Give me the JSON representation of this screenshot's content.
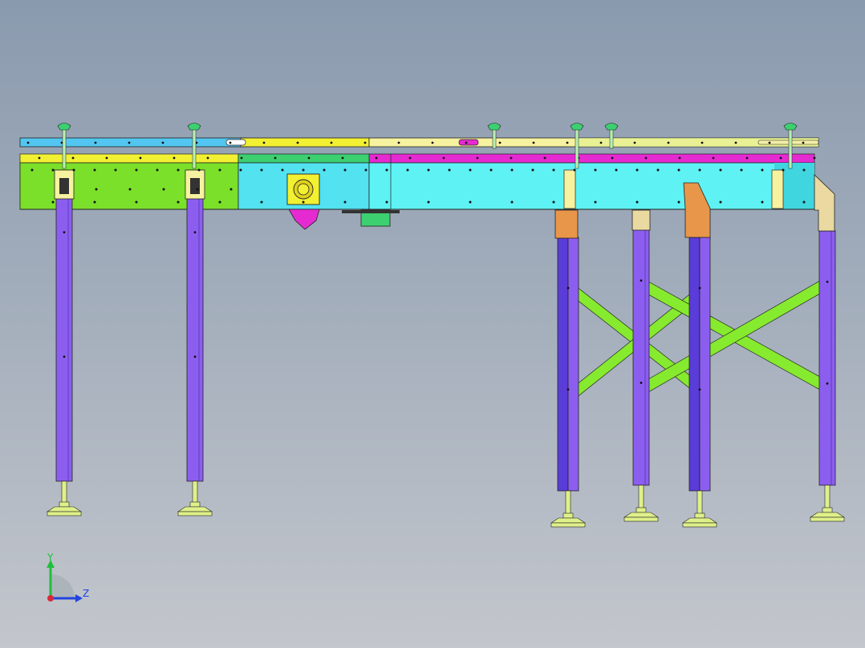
{
  "viewport": {
    "background_top": "#8a9aae",
    "background_bottom": "#c3c6cc"
  },
  "colors": {
    "conveyor_left_green": "#7be02a",
    "conveyor_left_blue_rail": "#52c6f0",
    "conveyor_yellow": "#f2f032",
    "conveyor_cyan": "#52f0f0",
    "conveyor_magenta": "#e62ad2",
    "conveyor_pale_rail": "#f6f2a0",
    "leg_purple": "#8c5ef0",
    "leg_dark_purple": "#5a3cd8",
    "brace_green": "#86ea2e",
    "bracket_orange": "#e8964a",
    "bracket_tan": "#ead9a0",
    "foot_yellow_green": "#dff08a",
    "handle_green": "#3cd070"
  },
  "triad": {
    "y_label": "Y",
    "z_label": "Z",
    "y_color": "#1fbf3a",
    "z_color": "#2244dd",
    "x_color": "#d8283a"
  }
}
